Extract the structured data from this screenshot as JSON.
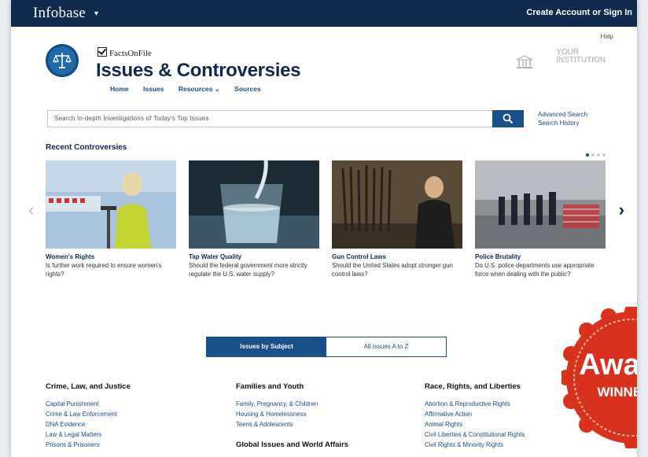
{
  "topbar": {
    "brand": "Infobase",
    "caret": "▾",
    "signin": "Create Account or Sign In"
  },
  "help": "Help",
  "logo": {
    "publisher": "FactsOnFile",
    "title": "Issues & Controversies"
  },
  "nav": [
    "Home",
    "Issues",
    "Resources ⌄",
    "Sources"
  ],
  "institution": {
    "line1": "YOUR",
    "line2": "INSTITUTION"
  },
  "search": {
    "placeholder": "Search In-depth Investigations of Today's Top Issues"
  },
  "advanced": {
    "advanced_search": "Advanced Search",
    "search_history": "Search History"
  },
  "recent": {
    "title": "Recent Controversies",
    "cards": [
      {
        "title": "Women's Rights",
        "desc": "Is further work required to ensure women's rights?"
      },
      {
        "title": "Tap Water Quality",
        "desc": "Should the federal government more strictly regulate the U.S. water supply?"
      },
      {
        "title": "Gun Control Laws",
        "desc": "Should the United States adopt stronger gun control laws?"
      },
      {
        "title": "Police Brutality",
        "desc": "Do U.S. police departments use appropriate force when dealing with the public?"
      }
    ]
  },
  "tabs": {
    "active": "Issues by Subject",
    "other": "All Issues A to Z"
  },
  "columns": [
    {
      "heading": "Crime, Law, and Justice",
      "items": [
        "Capital Punishment",
        "Crime & Law Enforcement",
        "DNA Evidence",
        "Law & Legal Matters",
        "Prisons & Prisoners"
      ]
    },
    {
      "heading": "Families and Youth",
      "items": [
        "Family, Pregnancy, & Children",
        "Housing & Homelessness",
        "Teens & Adolescents"
      ],
      "subheading": "Global Issues and World Affairs"
    },
    {
      "heading": "Race, Rights, and Liberties",
      "items": [
        "Abortion & Reproductive Rights",
        "Affirmative Action",
        "Animal Rights",
        "Civil Liberties & Constitutional Rights",
        "Civil Rights & Minority Rights"
      ]
    }
  ],
  "award": {
    "line1": "Award",
    "line2": "WINNER"
  },
  "colors": {
    "navy": "#0f2a4d",
    "blue": "#1b4f8a",
    "award_red": "#d8321f"
  }
}
